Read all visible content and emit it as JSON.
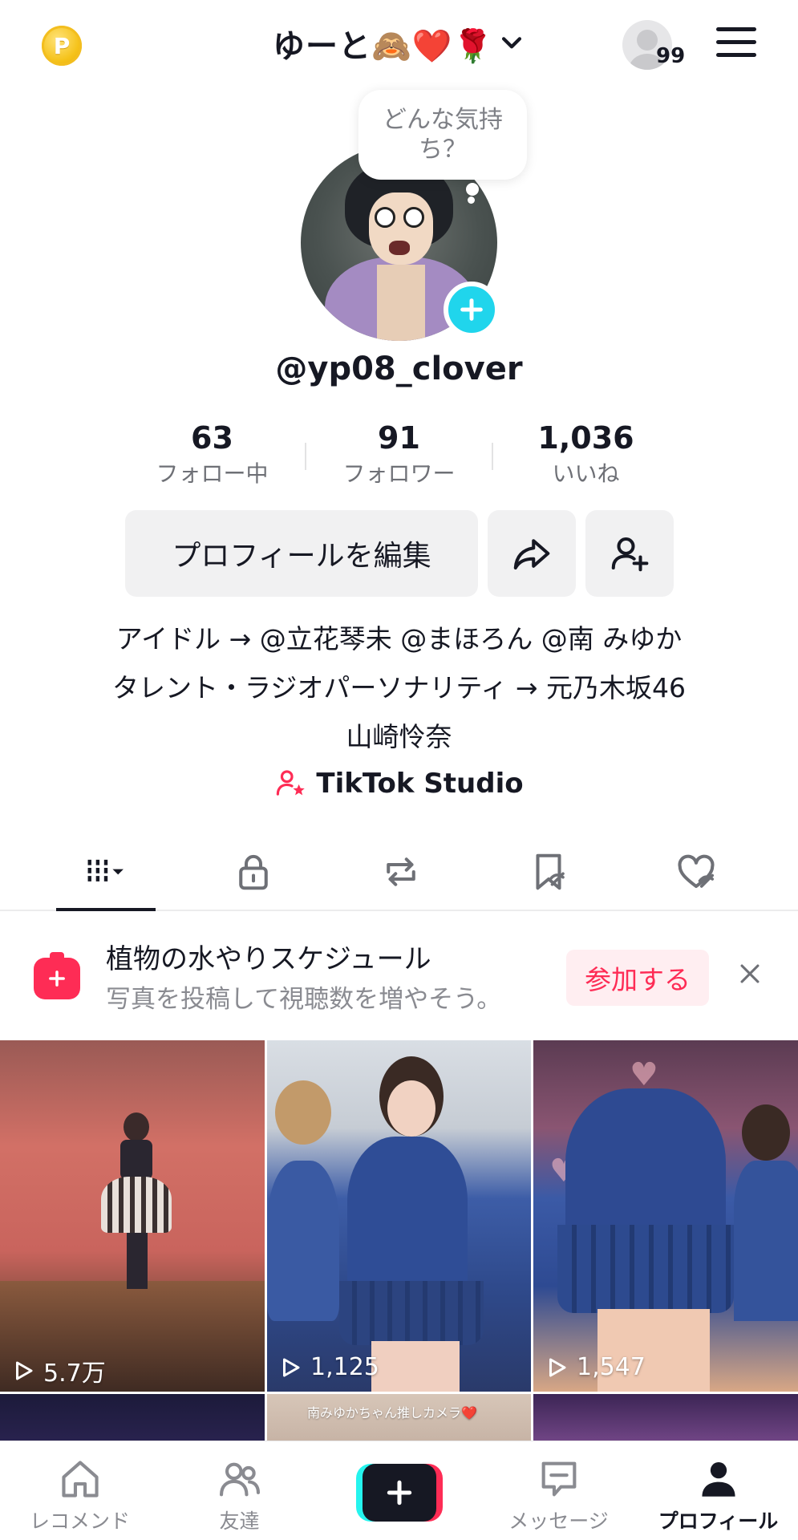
{
  "header": {
    "coin_letter": "P",
    "title": "ゆーと🙈❤️🌹",
    "notification_count": "99"
  },
  "profile": {
    "mood_bubble": "どんな気持ち？",
    "username": "@yp08_clover",
    "stats": [
      {
        "value": "63",
        "label": "フォロー中"
      },
      {
        "value": "91",
        "label": "フォロワー"
      },
      {
        "value": "1,036",
        "label": "いいね"
      }
    ],
    "edit_button": "プロフィールを編集",
    "bio_lines": [
      "アイドル → @立花琴未  @まほろん @南 みゆか",
      "タレント・ラジオパーソナリティ → 元乃木坂46",
      "山崎怜奈"
    ],
    "studio_link": "TikTok Studio"
  },
  "banner": {
    "title": "植物の水やりスケジュール",
    "subtitle": "写真を投稿して視聴数を増やそう。",
    "join_label": "参加する"
  },
  "videos": [
    {
      "views": "5.7万"
    },
    {
      "views": "1,125"
    },
    {
      "views": "1,547"
    },
    {
      "views": ""
    },
    {
      "views": "",
      "caption": "南みゆかちゃん推しカメラ❤️"
    },
    {
      "views": ""
    }
  ],
  "bottom_nav": [
    {
      "label": "レコメンド",
      "icon": "home-icon"
    },
    {
      "label": "友達",
      "icon": "friends-icon"
    },
    {
      "label": "",
      "icon": "create-icon"
    },
    {
      "label": "メッセージ",
      "icon": "inbox-icon"
    },
    {
      "label": "プロフィール",
      "icon": "profile-icon"
    }
  ],
  "colors": {
    "accent_pink": "#fe2c55",
    "accent_cyan": "#25f4ee",
    "plus_blue": "#20d5ec",
    "text": "#161823"
  }
}
